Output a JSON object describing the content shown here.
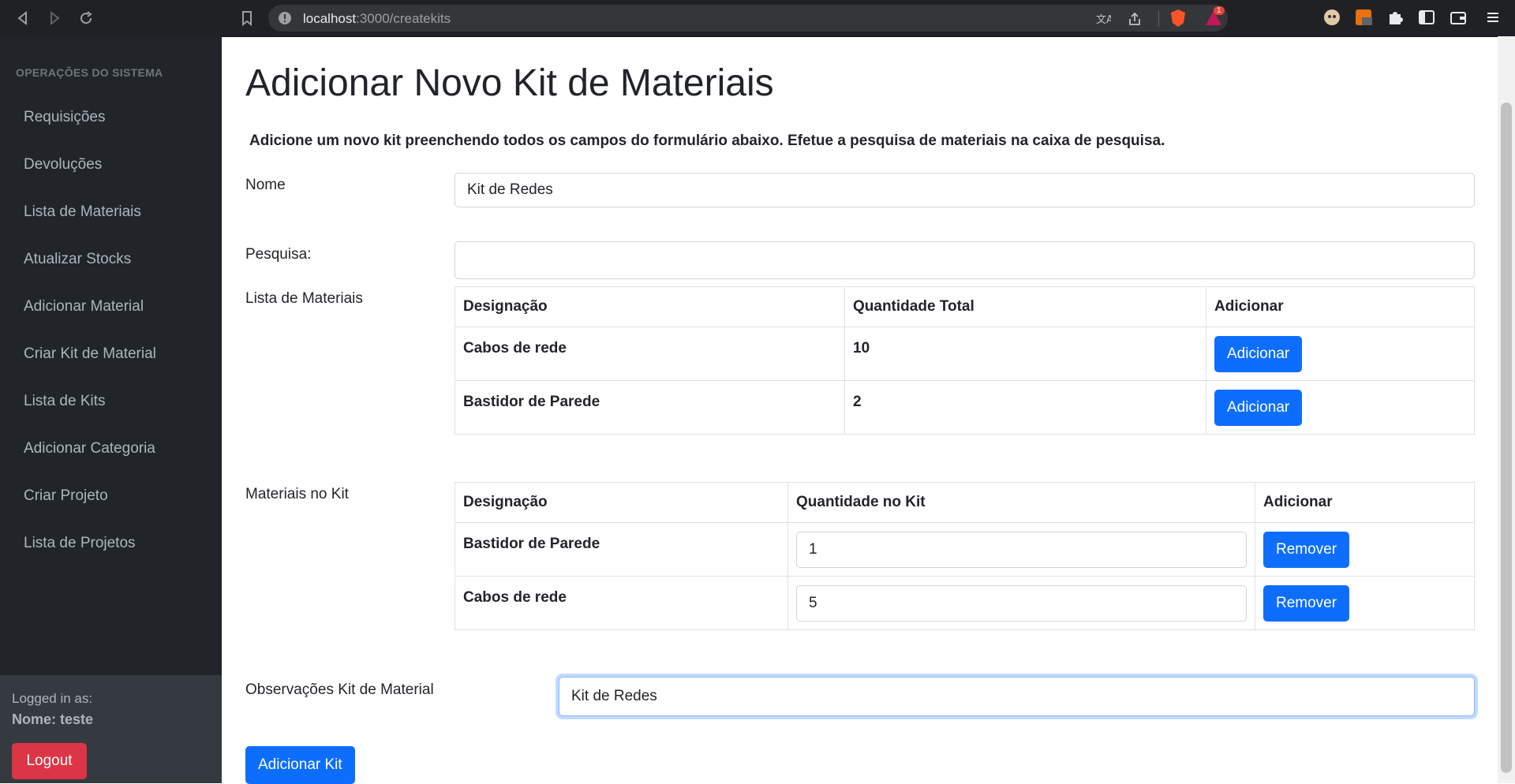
{
  "browser": {
    "url_host": "localhost",
    "url_path": ":3000/createkits",
    "notification_count": "1"
  },
  "sidebar": {
    "heading": "OPERAÇÕES DO SISTEMA",
    "items": [
      {
        "label": "Requisições"
      },
      {
        "label": "Devoluções"
      },
      {
        "label": "Lista de Materiais"
      },
      {
        "label": "Atualizar Stocks"
      },
      {
        "label": "Adicionar Material"
      },
      {
        "label": "Criar Kit de Material"
      },
      {
        "label": "Lista de Kits"
      },
      {
        "label": "Adicionar Categoria"
      },
      {
        "label": "Criar Projeto"
      },
      {
        "label": "Lista de Projetos"
      }
    ],
    "logged_in_label": "Logged in as:",
    "user_name": "Nome: teste",
    "logout_label": "Logout"
  },
  "main": {
    "title": "Adicionar Novo Kit de Materiais",
    "description": "Adicione um novo kit preenchendo todos os campos do formulário abaixo. Efetue a pesquisa de materiais na caixa de pesquisa.",
    "name_label": "Nome",
    "name_value": "Kit de Redes",
    "search_label": "Pesquisa:",
    "search_value": "",
    "materials_label": "Lista de Materiais",
    "materials_table": {
      "headers": [
        "Designação",
        "Quantidade Total",
        "Adicionar"
      ],
      "rows": [
        {
          "name": "Cabos de rede",
          "quantity": "10",
          "action": "Adicionar"
        },
        {
          "name": "Bastidor de Parede",
          "quantity": "2",
          "action": "Adicionar"
        }
      ]
    },
    "kit_label": "Materiais no Kit",
    "kit_table": {
      "headers": [
        "Designação",
        "Quantidade no Kit",
        "Adicionar"
      ],
      "rows": [
        {
          "name": "Bastidor de Parede",
          "quantity": "1",
          "action": "Remover"
        },
        {
          "name": "Cabos de rede",
          "quantity": "5",
          "action": "Remover"
        }
      ]
    },
    "notes_label": "Observações Kit de Material",
    "notes_value": "Kit de Redes",
    "submit_label": "Adicionar Kit"
  },
  "colors": {
    "primary": "#0d6efd",
    "danger": "#dc3545",
    "sidebar_bg": "#212529",
    "sidebar_footer_bg": "#343a40"
  }
}
